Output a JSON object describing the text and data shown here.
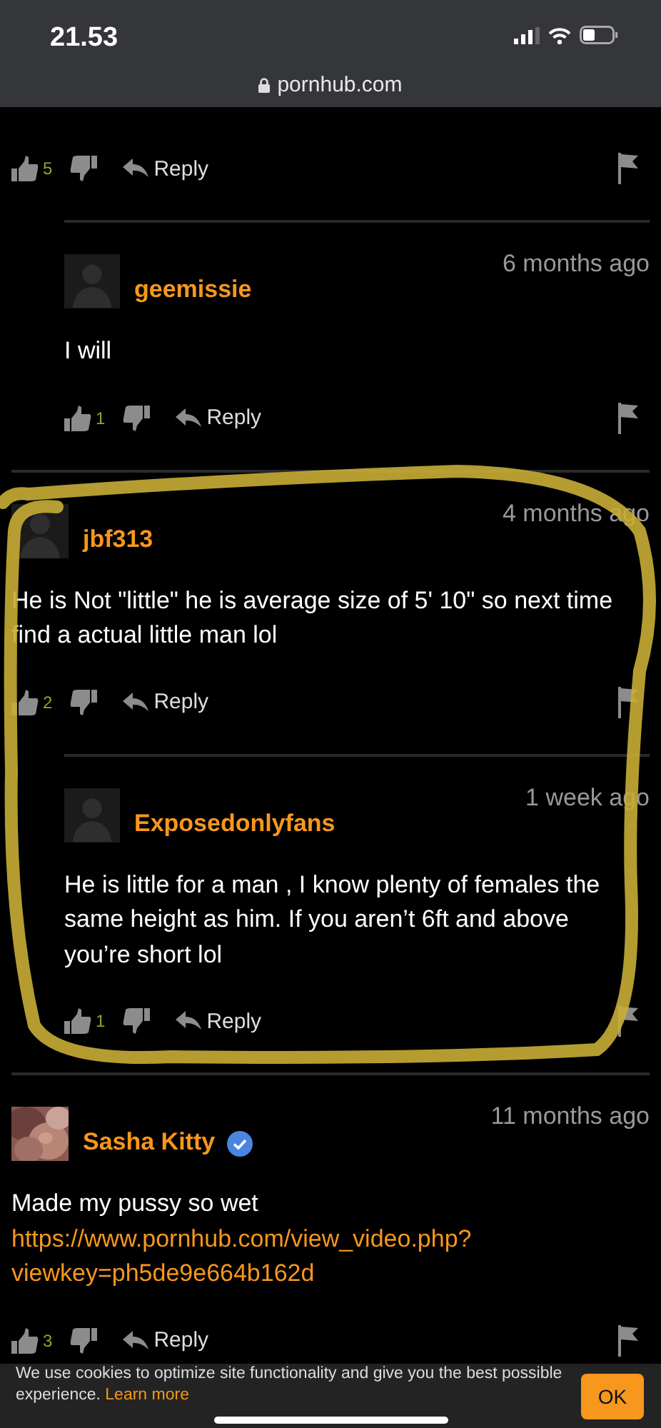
{
  "status_bar": {
    "time": "21.53",
    "url": "pornhub.com"
  },
  "comments": [
    {
      "likes": "5",
      "reply_label": "Reply",
      "children": [
        {
          "username": "geemissie",
          "avatar": {
            "kind": "silhouette"
          },
          "verified": false,
          "time": "6 months ago",
          "text": "I will",
          "likes": "1",
          "reply_label": "Reply"
        }
      ]
    },
    {
      "username": "jbf313",
      "avatar": {
        "kind": "silhouette"
      },
      "verified": false,
      "time": "4 months ago",
      "text": "He is Not \"little\" he is average size of 5' 10\" so next time find a actual little man lol",
      "likes": "2",
      "reply_label": "Reply",
      "children": [
        {
          "username": "Exposedonlyfans",
          "avatar": {
            "kind": "silhouette"
          },
          "verified": false,
          "time": "1 week ago",
          "text": "He is little for a man , I know plenty of females the same height as him. If you aren’t 6ft and above you’re short lol",
          "likes": "1",
          "reply_label": "Reply"
        }
      ]
    },
    {
      "username": "Sasha Kitty",
      "verified": true,
      "time": "11 months ago",
      "text": "Made my pussy so wet",
      "link": "https://www.pornhub.com/view_video.php?viewkey=ph5de9e664b162d",
      "likes": "3",
      "reply_label": "Reply"
    }
  ],
  "cookie_banner": {
    "text": "We use cookies to optimize site functionality and give you the best possible experience.",
    "link": "Learn more",
    "button": "OK"
  }
}
